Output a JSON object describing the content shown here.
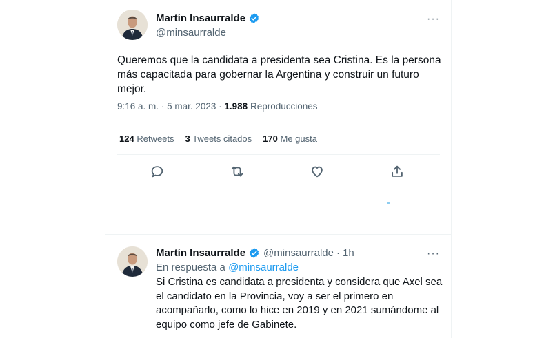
{
  "colors": {
    "accent": "#1d9bf0",
    "text": "#0f1419",
    "secondary": "#536471"
  },
  "main_tweet": {
    "author_name": "Martín Insaurralde",
    "author_handle": "@minsaurralde",
    "text": "Queremos que la candidata a presidenta sea Cristina. Es la persona más capacitada para gobernar la Argentina y construir un futuro mejor.",
    "time": "9:16 a. m.",
    "separator": "·",
    "date": "5 mar. 2023",
    "views_count": "1.988",
    "views_label": "Reproducciones",
    "more_icon": "···",
    "stats": {
      "retweets_count": "124",
      "retweets_label": "Retweets",
      "quotes_count": "3",
      "quotes_label": "Tweets citados",
      "likes_count": "170",
      "likes_label": "Me gusta"
    },
    "actions": [
      "reply-icon",
      "retweet-icon",
      "like-icon",
      "share-icon"
    ]
  },
  "reply_tweet": {
    "author_name": "Martín Insaurralde",
    "author_handle": "@minsaurralde",
    "separator": "·",
    "time_ago": "1h",
    "replying_prefix": "En respuesta a",
    "replying_to": "@minsaurralde",
    "text": "Si Cristina es candidata a presidenta y considera que Axel sea el candidato en la Provincia, voy a ser el primero en acompañarlo, como lo hice en 2019 y en 2021 sumándome al equipo como jefe de Gabinete.",
    "more_icon": "···"
  }
}
